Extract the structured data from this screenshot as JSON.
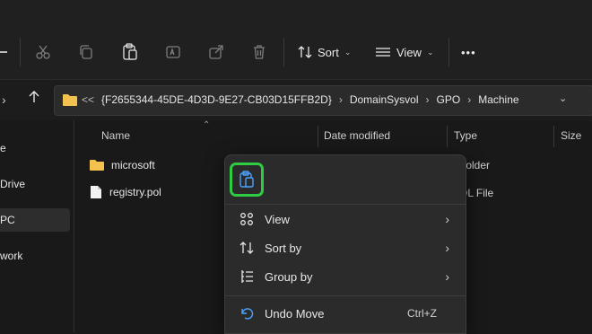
{
  "toolbar": {
    "sort_label": "Sort",
    "view_label": "View",
    "more_label": "•••",
    "icons": [
      "cut-icon",
      "copy-icon",
      "paste-icon",
      "rename-icon",
      "share-icon",
      "delete-icon"
    ]
  },
  "address": {
    "overflow": "<<",
    "crumbs": [
      "{F2655344-45DE-4D3D-9E27-CB03D15FFB2D}",
      "DomainSysvol",
      "GPO",
      "Machine"
    ]
  },
  "nav": {
    "items": [
      "e",
      "Drive",
      "PC",
      "work"
    ]
  },
  "columns": {
    "name": "Name",
    "date_modified": "Date modified",
    "type": "Type",
    "size": "Size"
  },
  "files": [
    {
      "name": "microsoft",
      "type": "e folder",
      "icon": "folder-icon"
    },
    {
      "name": "registry.pol",
      "type": "OL File",
      "icon": "file-icon"
    }
  ],
  "context_menu": {
    "items": [
      {
        "label": "View",
        "icon": "view-grid-icon",
        "submenu": true
      },
      {
        "label": "Sort by",
        "icon": "sort-icon",
        "submenu": true
      },
      {
        "label": "Group by",
        "icon": "group-icon",
        "submenu": true
      },
      {
        "label": "Undo Move",
        "icon": "undo-icon",
        "shortcut": "Ctrl+Z"
      }
    ]
  },
  "colors": {
    "highlight": "#2ecc40",
    "accent_blue": "#4aa3ff",
    "folder_yellow": "#f2c14e"
  }
}
